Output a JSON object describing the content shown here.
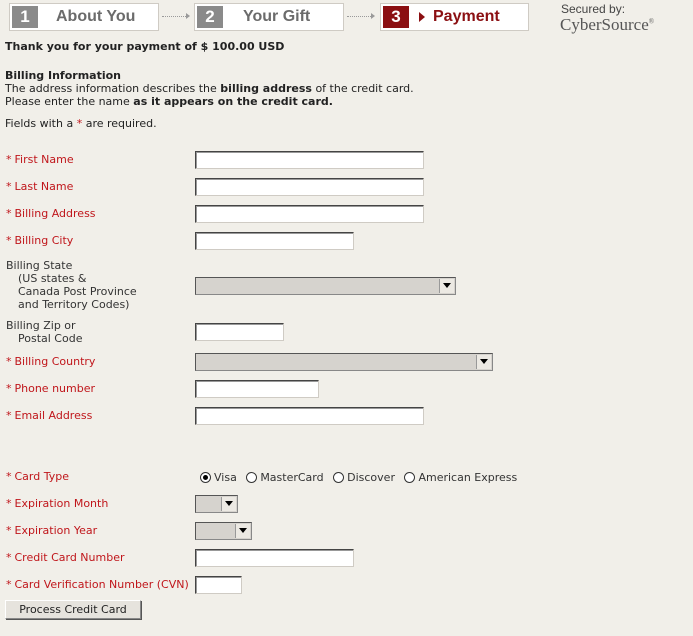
{
  "steps": [
    {
      "num": "1",
      "label": "About You"
    },
    {
      "num": "2",
      "label": "Your Gift"
    },
    {
      "num": "3",
      "label": "Payment"
    }
  ],
  "header": {
    "secured_label": "Secured by:",
    "brand": "CyberSource",
    "brand_mark": "®"
  },
  "payment_notice": "Thank you for your payment of $ 100.00 USD",
  "billing": {
    "heading": "Billing Information",
    "desc1_a": "The address information describes the ",
    "desc1_b": "billing address",
    "desc1_c": " of the credit card.",
    "desc2_a": "Please enter the name ",
    "desc2_b": "as it appears on the credit card.",
    "required_a": "Fields with a ",
    "required_star": "*",
    "required_b": " are required."
  },
  "fields": {
    "first_name": "First Name",
    "last_name": "Last Name",
    "billing_address": "Billing Address",
    "billing_city": "Billing City",
    "billing_state_1": "Billing State",
    "billing_state_2": "(US states &",
    "billing_state_3": "Canada Post Province",
    "billing_state_4": "and Territory Codes)",
    "zip_1": "Billing Zip or",
    "zip_2": "Postal Code",
    "billing_country": "Billing Country",
    "phone": "Phone number",
    "email": "Email Address",
    "card_type": "Card Type",
    "exp_month": "Expiration Month",
    "exp_year": "Expiration Year",
    "card_number": "Credit Card Number",
    "cvn": "Card Verification Number (CVN)"
  },
  "card_types": [
    "Visa",
    "MasterCard",
    "Discover",
    "American Express"
  ],
  "selected_card_type": "Visa",
  "required_star": "*",
  "submit_label": "Process Credit Card",
  "colors": {
    "accent": "#8b0f12",
    "required": "#c0161b",
    "background": "#f1efe9"
  }
}
